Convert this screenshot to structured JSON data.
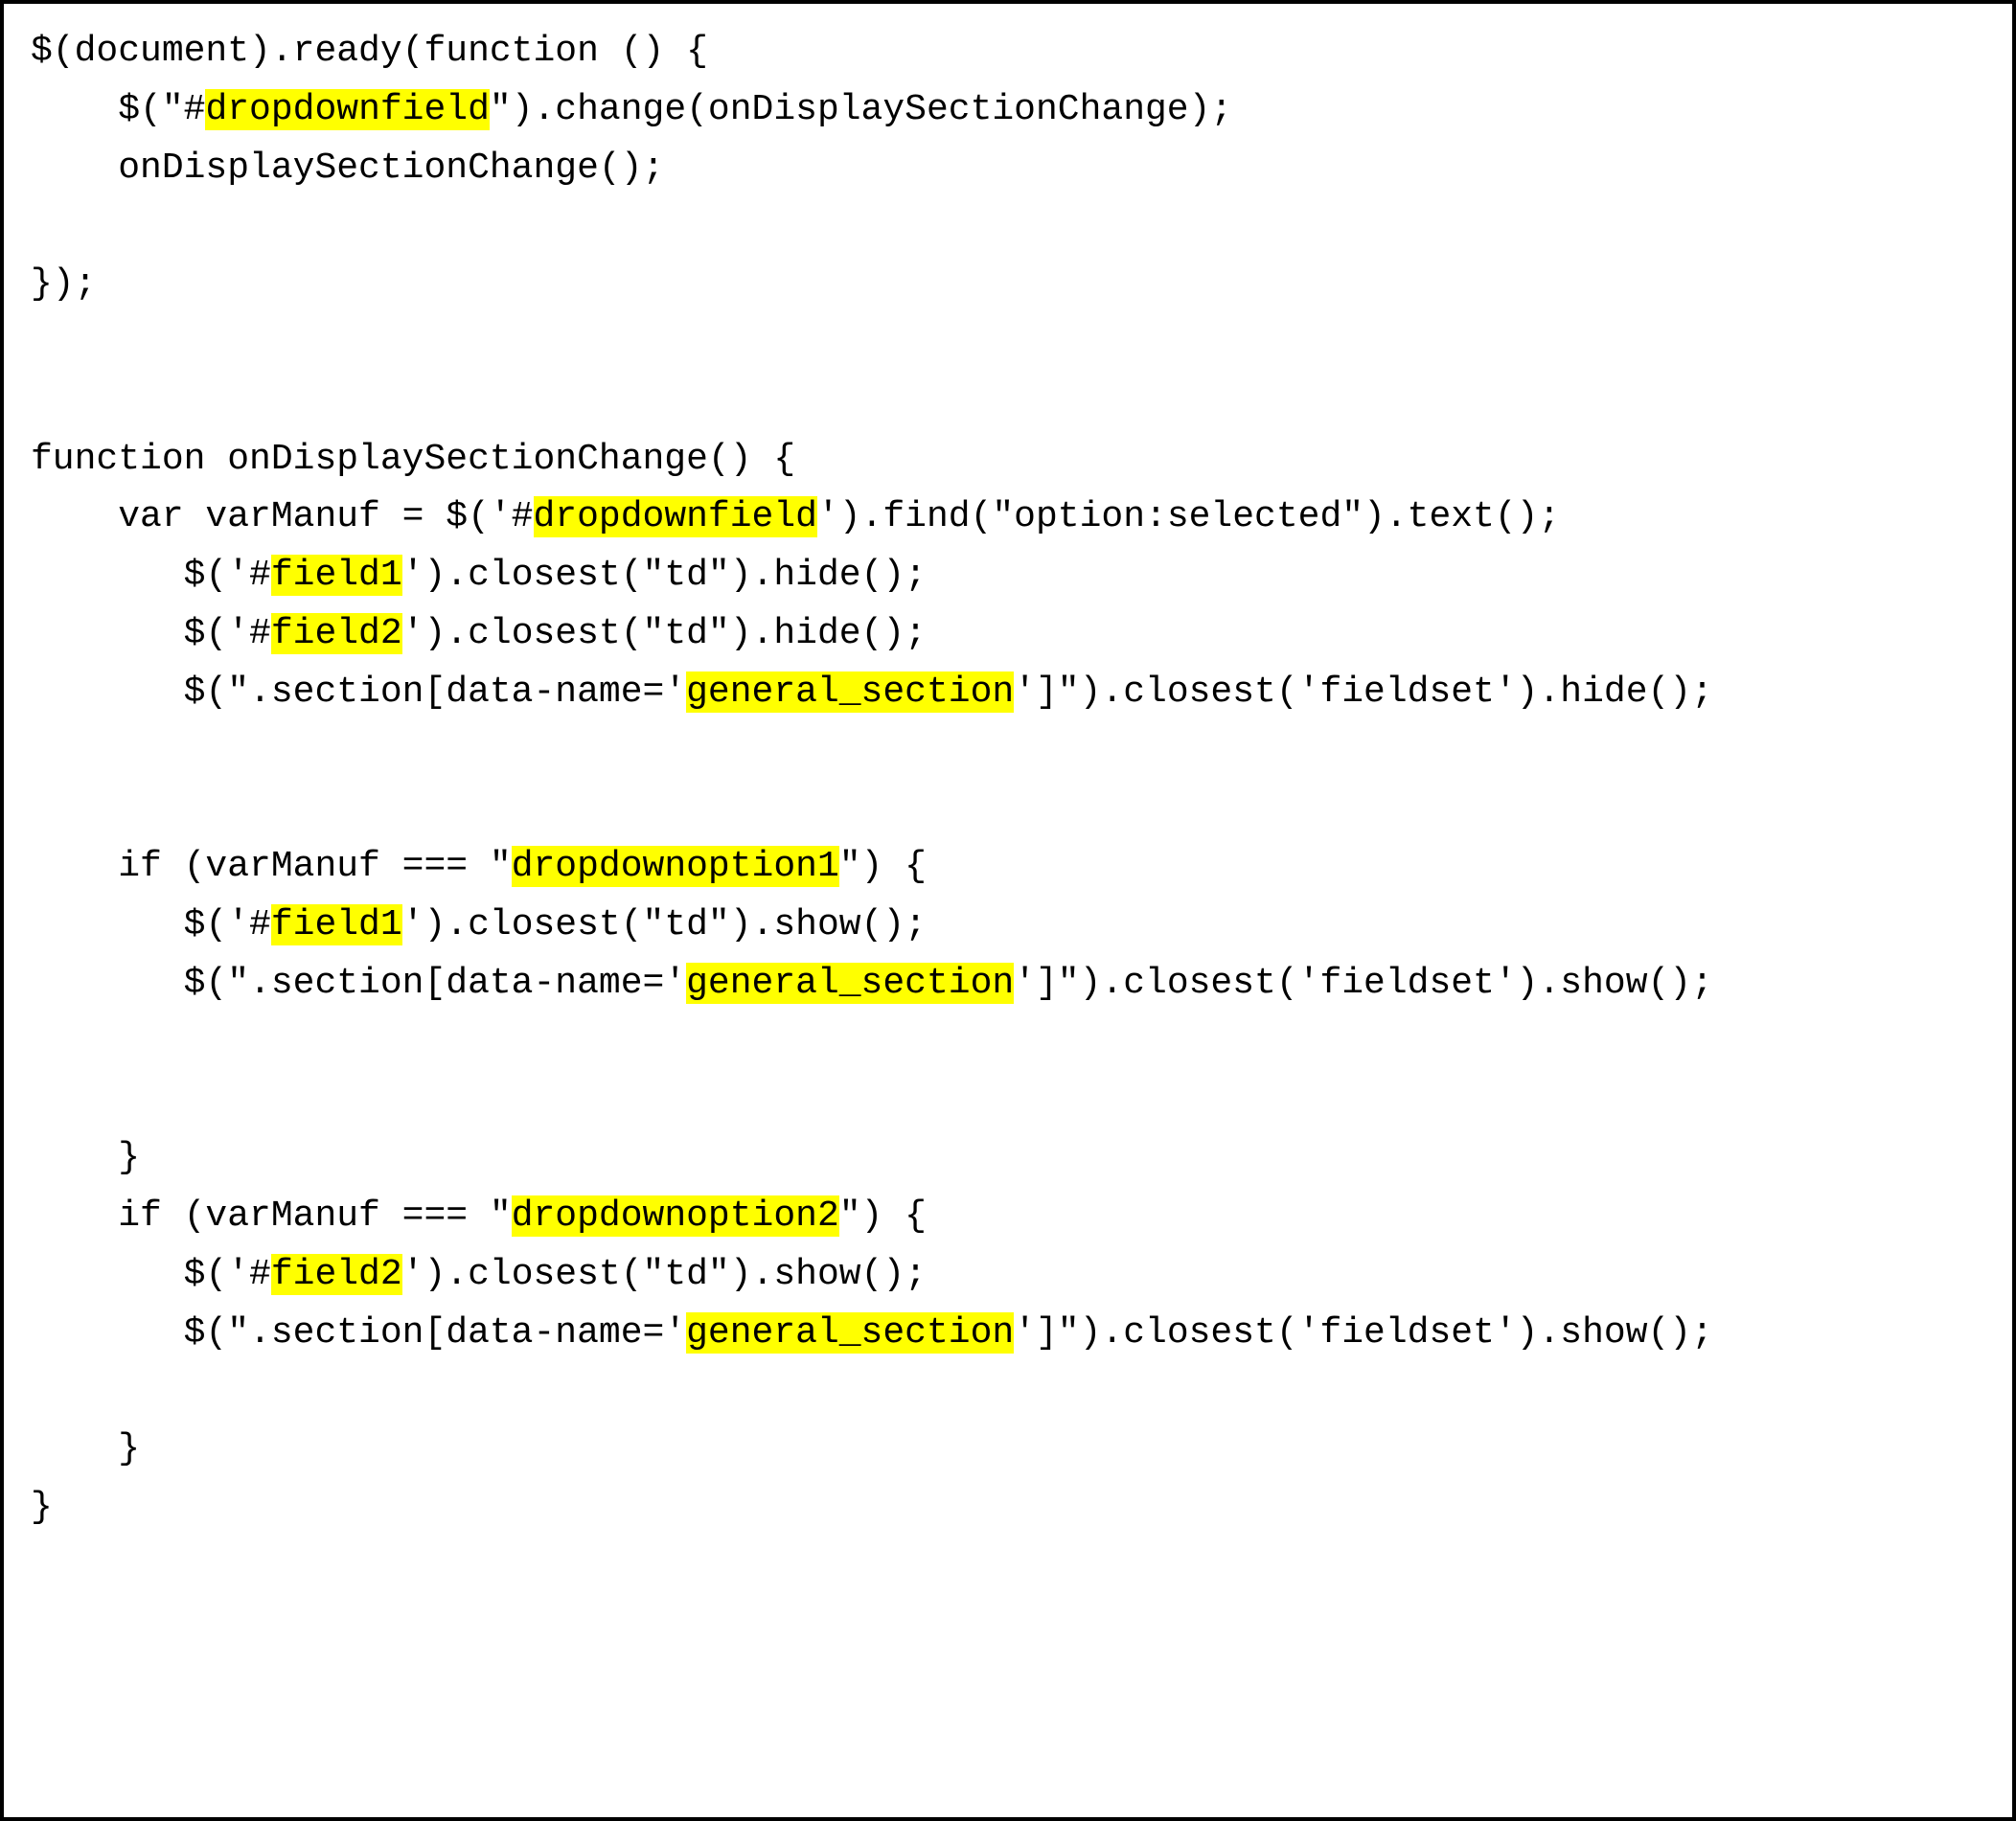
{
  "highlight_color": "#ffff00",
  "identifiers": {
    "dropdownfield": "dropdownfield",
    "field1": "field1",
    "field2": "field2",
    "general_section": "general_section",
    "dropdownoption1": "dropdownoption1",
    "dropdownoption2": "dropdownoption2"
  },
  "code_plain": "$(document).ready(function () {\n    $(\"#dropdownfield\").change(onDisplaySectionChange);\n    onDisplaySectionChange();\n\n});\n\n\nfunction onDisplaySectionChange() {\n    var varManuf = $('#dropdownfield').find(\"option:selected\").text();\n       $('#field1').closest(\"td\").hide();\n       $('#field2').closest(\"td\").hide();\n       $(\".section[data-name='general_section']\").closest('fieldset').hide();\n\n\n    if (varManuf === \"dropdownoption1\") {\n       $('#field1').closest(\"td\").show();\n       $(\".section[data-name='general_section']\").closest('fieldset').show();\n\n\n    }\n    if (varManuf === \"dropdownoption2\") {\n       $('#field2').closest(\"td\").show();\n       $(\".section[data-name='general_section']\").closest('fieldset').show();\n\n    }\n}",
  "lines": [
    {
      "pre": "$(document).ready(function () {",
      "hl": "",
      "post": ""
    },
    {
      "pre": "    $(\"#",
      "hl": "dropdownfield",
      "post": "\").change(onDisplaySectionChange);"
    },
    {
      "pre": "    onDisplaySectionChange();",
      "hl": "",
      "post": ""
    },
    {
      "pre": "",
      "hl": "",
      "post": ""
    },
    {
      "pre": "});",
      "hl": "",
      "post": ""
    },
    {
      "pre": "",
      "hl": "",
      "post": ""
    },
    {
      "pre": "",
      "hl": "",
      "post": ""
    },
    {
      "pre": "function onDisplaySectionChange() {",
      "hl": "",
      "post": ""
    },
    {
      "pre": "    var varManuf = $('#",
      "hl": "dropdownfield",
      "post": "').find(\"option:selected\").text();"
    },
    {
      "pre": "       $('#",
      "hl": "field1",
      "post": "').closest(\"td\").hide();"
    },
    {
      "pre": "       $('#",
      "hl": "field2",
      "post": "').closest(\"td\").hide();"
    },
    {
      "pre": "       $(\".section[data-name='",
      "hl": "general_section",
      "post": "']\").closest('fieldset').hide();"
    },
    {
      "pre": "",
      "hl": "",
      "post": ""
    },
    {
      "pre": "",
      "hl": "",
      "post": ""
    },
    {
      "pre": "    if (varManuf === \"",
      "hl": "dropdownoption1",
      "post": "\") {"
    },
    {
      "pre": "       $('#",
      "hl": "field1",
      "post": "').closest(\"td\").show();"
    },
    {
      "pre": "       $(\".section[data-name='",
      "hl": "general_section",
      "post": "']\").closest('fieldset').show();"
    },
    {
      "pre": "",
      "hl": "",
      "post": ""
    },
    {
      "pre": "",
      "hl": "",
      "post": ""
    },
    {
      "pre": "    }",
      "hl": "",
      "post": ""
    },
    {
      "pre": "    if (varManuf === \"",
      "hl": "dropdownoption2",
      "post": "\") {"
    },
    {
      "pre": "       $('#",
      "hl": "field2",
      "post": "').closest(\"td\").show();"
    },
    {
      "pre": "       $(\".section[data-name='",
      "hl": "general_section",
      "post": "']\").closest('fieldset').show();"
    },
    {
      "pre": "",
      "hl": "",
      "post": ""
    },
    {
      "pre": "    }",
      "hl": "",
      "post": ""
    },
    {
      "pre": "}",
      "hl": "",
      "post": ""
    }
  ]
}
